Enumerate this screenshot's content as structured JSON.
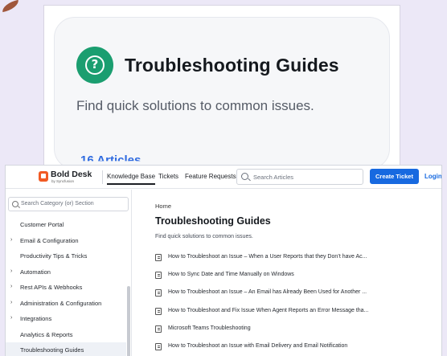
{
  "background": {
    "title": "Troubleshooting Guides",
    "subtitle": "Find quick solutions to common issues.",
    "partial_link": "16 Articles"
  },
  "header": {
    "brand": "Bold Desk",
    "brand_sub": "by Syncfusion",
    "nav": [
      "Knowledge Base",
      "Tickets",
      "Feature Requests"
    ],
    "search_placeholder": "Search Articles",
    "create_ticket": "Create Ticket",
    "login": "Login"
  },
  "sidebar": {
    "search_placeholder": "Search Category (or) Section",
    "items": [
      {
        "label": "Customer Portal",
        "expandable": false
      },
      {
        "label": "Email & Configuration",
        "expandable": true
      },
      {
        "label": "Productivity Tips & Tricks",
        "expandable": false
      },
      {
        "label": "Automation",
        "expandable": true
      },
      {
        "label": "Rest APIs & Webhooks",
        "expandable": true
      },
      {
        "label": "Administration & Configuration",
        "expandable": true
      },
      {
        "label": "Integrations",
        "expandable": true
      },
      {
        "label": "Analytics & Reports",
        "expandable": false
      },
      {
        "label": "Troubleshooting Guides",
        "expandable": false
      }
    ],
    "active_item": "Troubleshooting Guides"
  },
  "main": {
    "breadcrumb": "Home",
    "title": "Troubleshooting Guides",
    "description": "Find quick solutions to common issues.",
    "articles": [
      "How to Troubleshoot an Issue – When a User Reports that they Don’t have Ac...",
      "How to Sync Date and Time Manually on Windows",
      "How to Troubleshoot an Issue – An Email has Already Been Used for Another ...",
      "How to Troubleshoot and Fix Issue When Agent Reports an Error Message tha...",
      "Microsoft Teams Troubleshooting",
      "How to Troubleshoot an Issue with Email Delivery and Email Notification"
    ]
  },
  "colors": {
    "accent": "#1769e0",
    "icon_green": "#1b9e70",
    "brand_orange": "#f15a24",
    "page_bg": "#ece8f7"
  }
}
